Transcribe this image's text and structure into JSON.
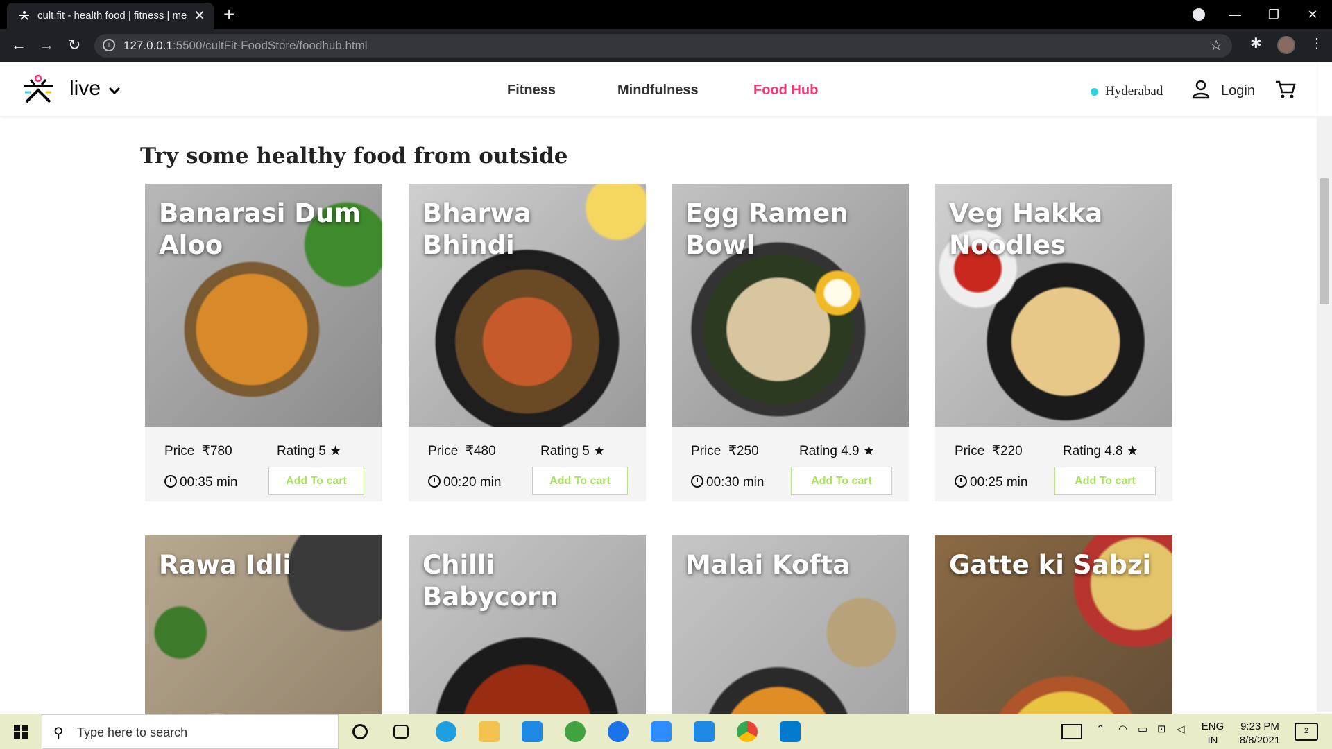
{
  "browser": {
    "tab_title": "cult.fit - health food | fitness | me",
    "new_tab": "+",
    "url_host": "127.0.0.1",
    "url_path": ":5500/cultFit-FoodStore/foodhub.html"
  },
  "header": {
    "brand": "live",
    "nav": [
      "Fitness",
      "Mindfulness",
      "Food Hub"
    ],
    "active_nav": "Food Hub",
    "city": "Hyderabad",
    "login": "Login",
    "accent": "#ff3278"
  },
  "section_title": "Try some healthy food from outside",
  "price_label": "Price",
  "rating_label": "Rating",
  "cart_label": "Add To cart",
  "cards": [
    {
      "name": "Banarasi Dum Aloo",
      "price": "₹780",
      "rating": "5",
      "time": "00:35 min"
    },
    {
      "name": "Bharwa Bhindi",
      "price": "₹480",
      "rating": "5",
      "time": "00:20 min"
    },
    {
      "name": "Egg Ramen Bowl",
      "price": "₹250",
      "rating": "4.9",
      "time": "00:30 min"
    },
    {
      "name": "Veg Hakka Noodles",
      "price": "₹220",
      "rating": "4.8",
      "time": "00:25 min"
    },
    {
      "name": "Rawa Idli"
    },
    {
      "name": "Chilli Babycorn"
    },
    {
      "name": "Malai Kofta"
    },
    {
      "name": "Gatte ki Sabzi"
    }
  ],
  "taskbar": {
    "search_placeholder": "Type here to search",
    "lang_top": "ENG",
    "lang_bottom": "IN",
    "time": "9:23 PM",
    "date": "8/8/2021",
    "notif_count": "2"
  }
}
